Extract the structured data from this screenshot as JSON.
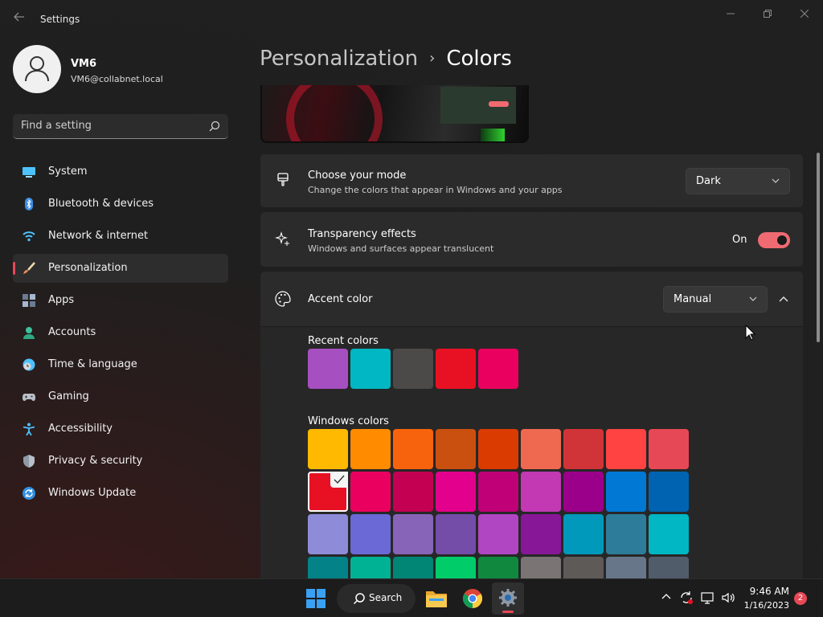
{
  "window": {
    "title": "Settings",
    "controls": {
      "minimize": "minimize",
      "maximize": "maximize",
      "close": "close"
    }
  },
  "user": {
    "name": "VM6",
    "email": "VM6@collabnet.local"
  },
  "search": {
    "placeholder": "Find a setting"
  },
  "sidebar": {
    "items": [
      {
        "label": "System",
        "icon": "system-icon"
      },
      {
        "label": "Bluetooth & devices",
        "icon": "bluetooth-icon"
      },
      {
        "label": "Network & internet",
        "icon": "wifi-icon"
      },
      {
        "label": "Personalization",
        "icon": "brush-icon",
        "active": true
      },
      {
        "label": "Apps",
        "icon": "apps-icon"
      },
      {
        "label": "Accounts",
        "icon": "accounts-icon"
      },
      {
        "label": "Time & language",
        "icon": "clock-globe-icon"
      },
      {
        "label": "Gaming",
        "icon": "gamepad-icon"
      },
      {
        "label": "Accessibility",
        "icon": "accessibility-icon"
      },
      {
        "label": "Privacy & security",
        "icon": "shield-icon"
      },
      {
        "label": "Windows Update",
        "icon": "update-icon"
      }
    ]
  },
  "breadcrumb": {
    "parent": "Personalization",
    "separator": "›",
    "current": "Colors"
  },
  "mode": {
    "title": "Choose your mode",
    "subtitle": "Change the colors that appear in Windows and your apps",
    "value": "Dark"
  },
  "transparency": {
    "title": "Transparency effects",
    "subtitle": "Windows and surfaces appear translucent",
    "state_label": "On",
    "on": true
  },
  "accent": {
    "title": "Accent color",
    "value": "Manual",
    "expanded": true,
    "recent_label": "Recent colors",
    "recent_colors": [
      "#a64fc1",
      "#00b7c3",
      "#4c4a48",
      "#e81123",
      "#ea005e"
    ],
    "windows_label": "Windows colors",
    "windows_colors": [
      [
        "#ffb900",
        "#ff8c00",
        "#f7630c",
        "#ca5010",
        "#da3b01",
        "#ef6950",
        "#d13438",
        "#ff4343",
        "#e74856"
      ],
      [
        "#e81123",
        "#ea005e",
        "#c30052",
        "#e3008c",
        "#bf0077",
        "#c239b3",
        "#9a0089",
        "#0078d4",
        "#0063b1"
      ],
      [
        "#8e8cd8",
        "#6b69d6",
        "#8764b8",
        "#744da9",
        "#b146c2",
        "#881798",
        "#0099bc",
        "#2d7d9a",
        "#00b7c3"
      ],
      [
        "#038387",
        "#00b294",
        "#018574",
        "#00cc6a",
        "#10893e",
        "#7a7574",
        "#5d5a58",
        "#68768a",
        "#515c6b"
      ]
    ],
    "selected": [
      1,
      0
    ]
  },
  "taskbar": {
    "search_label": "Search",
    "apps": [
      "windows-start-icon",
      "file-explorer-icon",
      "chrome-icon",
      "settings-icon"
    ],
    "clock_time": "9:46 AM",
    "clock_date": "1/16/2023",
    "notification_count": "2"
  },
  "colors": {
    "accent": "#e74856",
    "toggle_on": "#ef6b71",
    "background": "#202020",
    "card": "#2b2b2b"
  }
}
